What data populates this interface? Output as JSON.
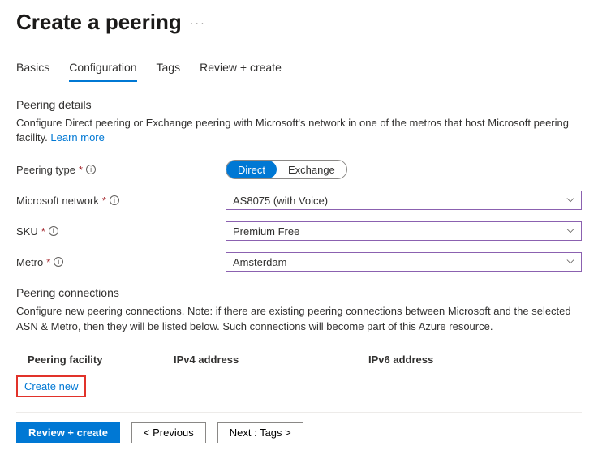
{
  "header": {
    "title": "Create a peering"
  },
  "tabs": [
    {
      "label": "Basics",
      "active": false
    },
    {
      "label": "Configuration",
      "active": true
    },
    {
      "label": "Tags",
      "active": false
    },
    {
      "label": "Review + create",
      "active": false
    }
  ],
  "peeringDetails": {
    "heading": "Peering details",
    "description": "Configure Direct peering or Exchange peering with Microsoft's network in one of the metros that host Microsoft peering facility. ",
    "learnMore": "Learn more"
  },
  "form": {
    "peeringType": {
      "label": "Peering type",
      "options": [
        "Direct",
        "Exchange"
      ],
      "selected": "Direct"
    },
    "microsoftNetwork": {
      "label": "Microsoft network",
      "value": "AS8075 (with Voice)"
    },
    "sku": {
      "label": "SKU",
      "value": "Premium Free"
    },
    "metro": {
      "label": "Metro",
      "value": "Amsterdam"
    }
  },
  "connections": {
    "heading": "Peering connections",
    "description": "Configure new peering connections. Note: if there are existing peering connections between Microsoft and the selected ASN & Metro, then they will be listed below. Such connections will become part of this Azure resource.",
    "columns": [
      "Peering facility",
      "IPv4 address",
      "IPv6 address"
    ],
    "createNew": "Create new"
  },
  "footer": {
    "reviewCreate": "Review + create",
    "previous": "< Previous",
    "next": "Next : Tags >"
  }
}
